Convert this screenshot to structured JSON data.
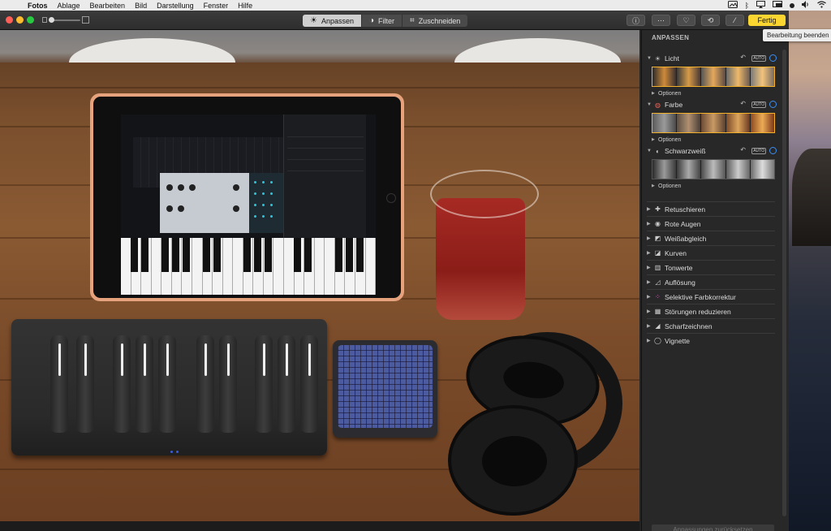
{
  "menubar": {
    "items": [
      "Fotos",
      "Ablage",
      "Bearbeiten",
      "Bild",
      "Darstellung",
      "Fenster",
      "Hilfe"
    ],
    "status_icons": [
      "photos-menu-icon",
      "bluetooth-icon",
      "airplay-icon",
      "display-icon",
      "record-icon",
      "volume-icon",
      "wifi-icon"
    ]
  },
  "toolbar": {
    "tabs": [
      {
        "label": "Anpassen",
        "icon": "sun-icon"
      },
      {
        "label": "Filter",
        "icon": "filter-icon"
      },
      {
        "label": "Zuschneiden",
        "icon": "crop-icon"
      }
    ],
    "active_tab": "Anpassen",
    "buttons": [
      "info-icon",
      "more-icon",
      "heart-icon",
      "rotate-icon",
      "magic-wand-icon"
    ],
    "done_label": "Fertig",
    "done_color": "#fcd630",
    "tooltip": "Bearbeitung beenden"
  },
  "sidebar": {
    "heading": "ANPASSEN",
    "sections": [
      {
        "label": "Licht",
        "icon": "sun-icon",
        "auto": "AUTO",
        "options": "Optionen"
      },
      {
        "label": "Farbe",
        "icon": "color-wheel-icon",
        "auto": "AUTO",
        "options": "Optionen"
      },
      {
        "label": "Schwarzweiß",
        "icon": "half-circle-icon",
        "auto": "AUTO",
        "options": "Optionen"
      }
    ],
    "tools": [
      {
        "label": "Retuschieren",
        "icon": "bandage-icon"
      },
      {
        "label": "Rote Augen",
        "icon": "eye-icon"
      },
      {
        "label": "Weißabgleich",
        "icon": "white-balance-icon"
      },
      {
        "label": "Kurven",
        "icon": "curves-icon"
      },
      {
        "label": "Tonwerte",
        "icon": "levels-icon"
      },
      {
        "label": "Auflösung",
        "icon": "definition-icon"
      },
      {
        "label": "Selektive Farbkorrektur",
        "icon": "selective-color-icon"
      },
      {
        "label": "Störungen reduzieren",
        "icon": "noise-icon"
      },
      {
        "label": "Scharfzeichnen",
        "icon": "sharpen-icon"
      },
      {
        "label": "Vignette",
        "icon": "vignette-icon"
      }
    ],
    "reset_label": "Anpassungen zurücksetzen",
    "accent": "#3b8ef5"
  }
}
